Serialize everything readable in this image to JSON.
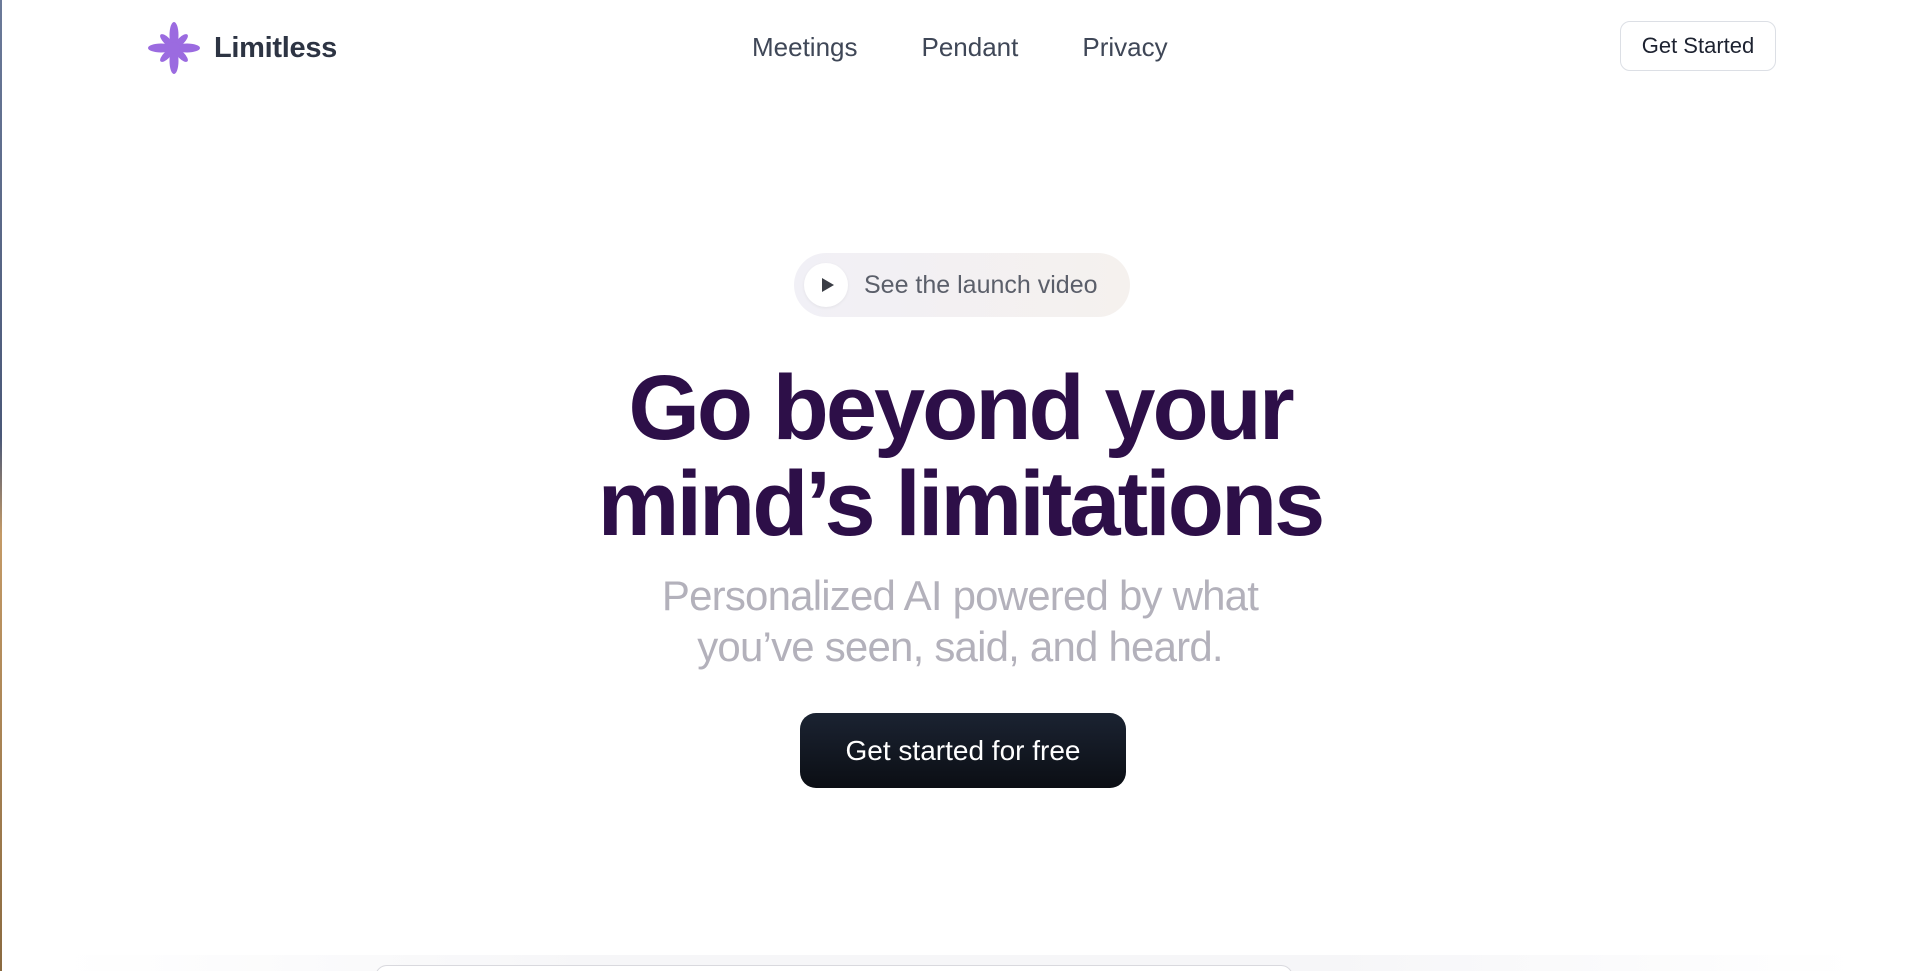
{
  "header": {
    "brand_name": "Limitless",
    "logo_icon": "purple-sparkle-flower",
    "nav": [
      {
        "label": "Meetings"
      },
      {
        "label": "Pendant"
      },
      {
        "label": "Privacy"
      }
    ],
    "cta_label": "Get Started"
  },
  "hero": {
    "video_pill_label": "See the launch video",
    "video_icon": "play-icon",
    "headline_line1": "Go beyond your",
    "headline_line2": "mind’s limitations",
    "subhead_line1": "Personalized AI powered by what",
    "subhead_line2": "you’ve seen, said, and heard.",
    "cta_label": "Get started for free"
  },
  "colors": {
    "brand_purple": "#9b6be0",
    "headline": "#2d0f48",
    "subhead": "#b3b1bb",
    "cta_bg": "#111722"
  }
}
